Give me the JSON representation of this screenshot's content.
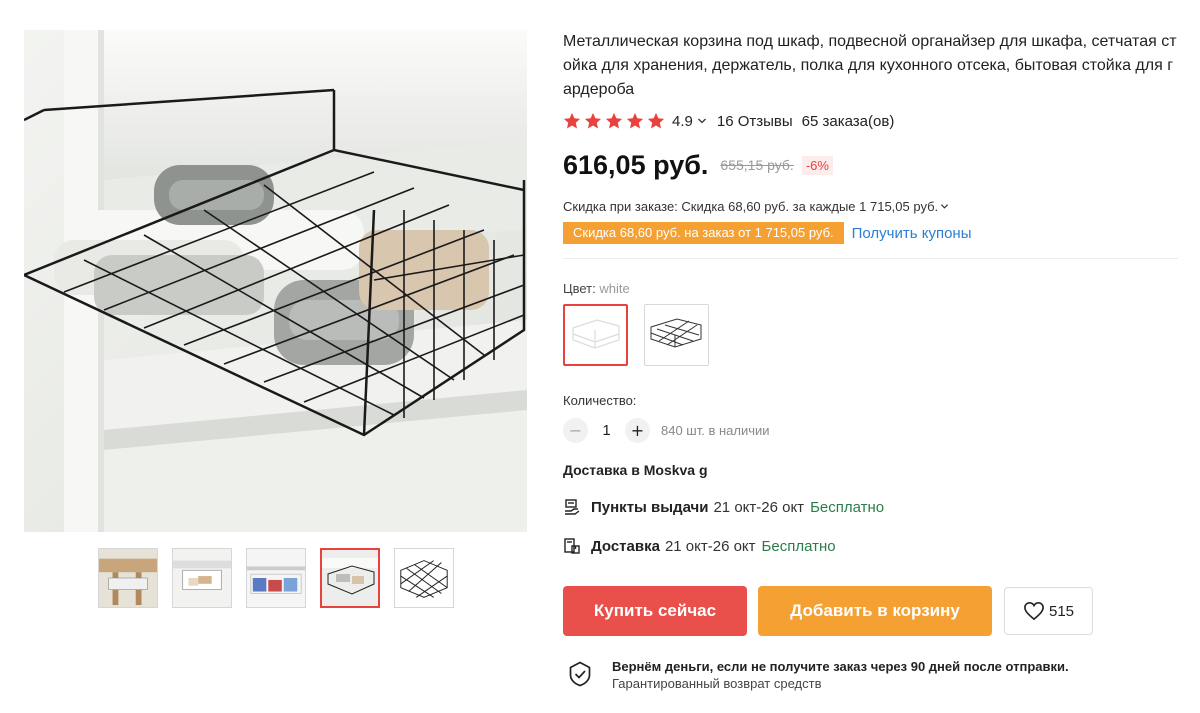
{
  "product": {
    "title": "Металлическая корзина под шкаф, подвесной органайзер для шкафа, сетчатая стойка для хранения, держатель, полка для кухонного отсека, бытовая стойка для гардероба",
    "rating": "4.9",
    "reviews": "16 Отзывы",
    "orders": "65 заказа(ов)",
    "stars": 5
  },
  "price": {
    "current": "616,05 руб.",
    "original": "655,15 руб.",
    "discount": "-6%"
  },
  "promo": {
    "discount_text": "Скидка при заказе: Скидка 68,60 руб. за каждые 1 715,05 руб.",
    "coupon_tag": "Скидка 68,60 руб. на заказ от 1 715,05 руб.",
    "coupon_link": "Получить купоны"
  },
  "color": {
    "label": "Цвет:",
    "selected": "white"
  },
  "quantity": {
    "label": "Количество:",
    "minus": "−",
    "value": "1",
    "plus": "+",
    "stock": "840 шт. в наличии"
  },
  "shipping": {
    "title": "Доставка в Moskva g",
    "pickup_label": "Пункты выдачи",
    "pickup_dates": "21 окт-26 окт",
    "pickup_price": "Бесплатно",
    "delivery_label": "Доставка",
    "delivery_dates": "21 окт-26 окт",
    "delivery_price": "Бесплатно"
  },
  "actions": {
    "buy_now": "Купить сейчас",
    "add_to_cart": "Добавить в корзину",
    "wishlist_count": "515"
  },
  "guarantee": {
    "title": "Вернём деньги, если не получите заказ через 90 дней после отправки.",
    "subtitle": "Гарантированный возврат средств"
  },
  "colors": {
    "accent_red": "#e9504c",
    "accent_orange": "#f5a033",
    "link_blue": "#2b7ed3",
    "free_green": "#2a7d4a"
  },
  "icons": [
    "star-icon",
    "chevron-down-icon",
    "pickup-point-icon",
    "delivery-box-icon",
    "heart-icon",
    "shield-check-icon"
  ]
}
